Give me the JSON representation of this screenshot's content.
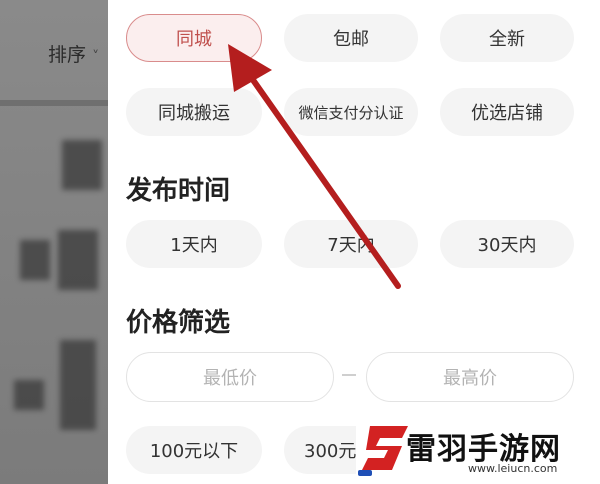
{
  "background": {
    "sort_label": "排序",
    "chevron_glyph": "˅"
  },
  "filters": {
    "row1": [
      "同城",
      "包邮",
      "全新"
    ],
    "row2": [
      "同城搬运",
      "微信支付分认证",
      "优选店铺"
    ],
    "selected": "同城"
  },
  "publish_time": {
    "title": "发布时间",
    "options": [
      "1天内",
      "7天内",
      "30天内"
    ]
  },
  "price": {
    "title": "价格筛选",
    "min_placeholder": "最低价",
    "max_placeholder": "最高价",
    "options": [
      "100元以下",
      "300元"
    ]
  },
  "watermark": {
    "title": "雷羽手游网",
    "url": "www.leiucn.com"
  },
  "colors": {
    "selected_text": "#c0504d",
    "selected_border": "#d98c8c",
    "annotation_arrow": "#b41e1e",
    "chip_bg": "#f4f4f4"
  }
}
